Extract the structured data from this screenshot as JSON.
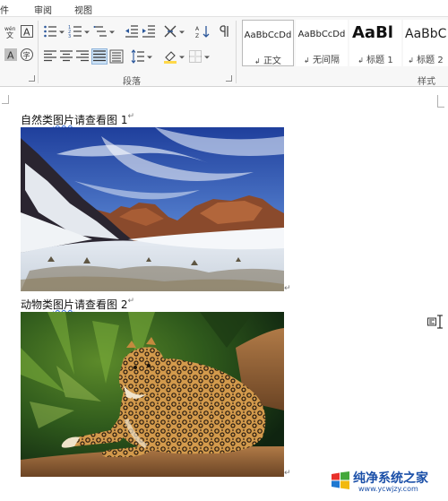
{
  "menu": {
    "items": [
      "邮件",
      "审阅",
      "视图"
    ],
    "first_visible": "件"
  },
  "ribbon": {
    "paragraph_group_label": "段落",
    "styles_group_label": "样式",
    "styles": [
      {
        "sample": "AaBbCcDd",
        "name": "正文",
        "selected": true
      },
      {
        "sample": "AaBbCcDd",
        "name": "无间隔",
        "selected": false
      },
      {
        "sample": "AaBl",
        "name": "标题 1",
        "selected": false
      },
      {
        "sample": "AaBbC",
        "name": "标题 2",
        "selected": false
      }
    ],
    "font_buttons": {
      "phonetic": "wén",
      "border_char": "A",
      "shade_char": "A",
      "enclose_char": "字"
    }
  },
  "document": {
    "para1": {
      "text": "自然类图片请查看图 1",
      "squiggle_part": "图片"
    },
    "para2": {
      "text": "动物类图片请查看图 2",
      "squiggle_part": "图片"
    },
    "image1": {
      "subject": "mountain snow landscape"
    },
    "image2": {
      "subject": "jaguar on log"
    }
  },
  "watermark": {
    "title": "纯净系统之家",
    "url": "www.ycwjzy.com"
  },
  "colors": {
    "accent_blue": "#2b579a",
    "ribbon_bg": "#f7f7f7"
  }
}
